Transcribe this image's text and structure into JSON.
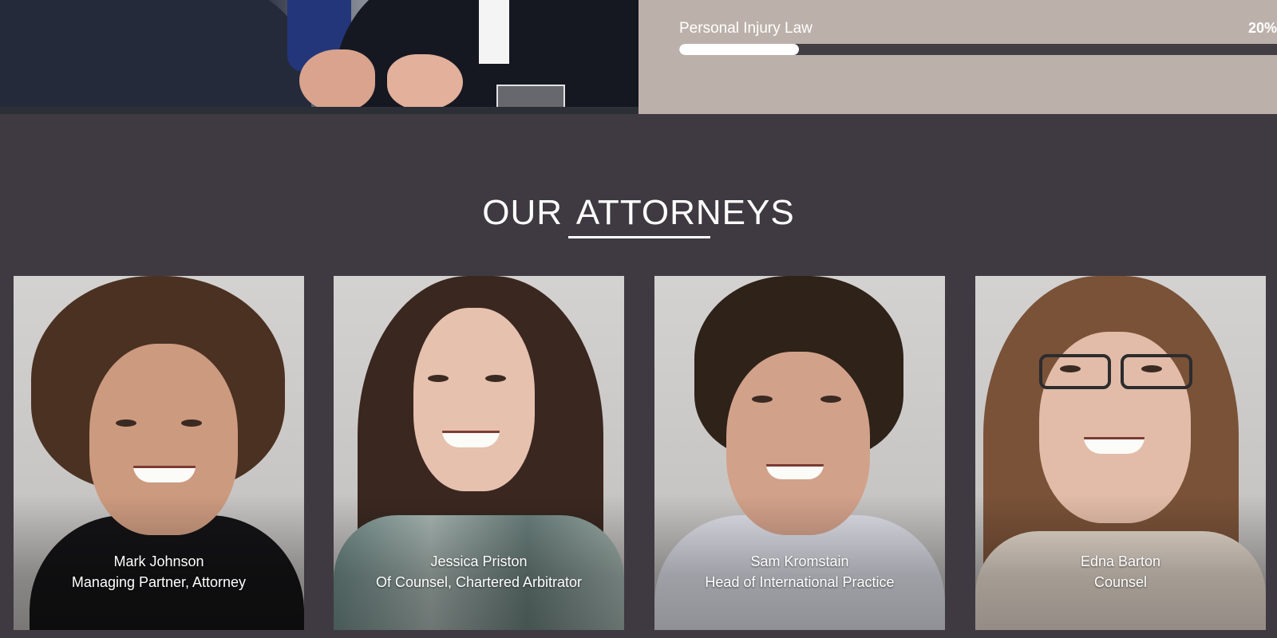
{
  "skills": {
    "label": "Personal Injury Law",
    "percent_text": "20%",
    "progress_fraction": 0.2
  },
  "section": {
    "title": "OUR ATTORNEYS"
  },
  "attorneys": [
    {
      "name": "Mark Johnson",
      "role": "Managing Partner, Attorney"
    },
    {
      "name": "Jessica Priston",
      "role": "Of Counsel, Chartered Arbitrator"
    },
    {
      "name": "Sam Kromstain",
      "role": "Head of International Practice"
    },
    {
      "name": "Edna Barton",
      "role": "Counsel"
    }
  ],
  "colors": {
    "page_background": "#3f3a41",
    "skills_panel": "#bcb1aa",
    "progress_track": "#433d44",
    "progress_fill": "#ffffff"
  }
}
